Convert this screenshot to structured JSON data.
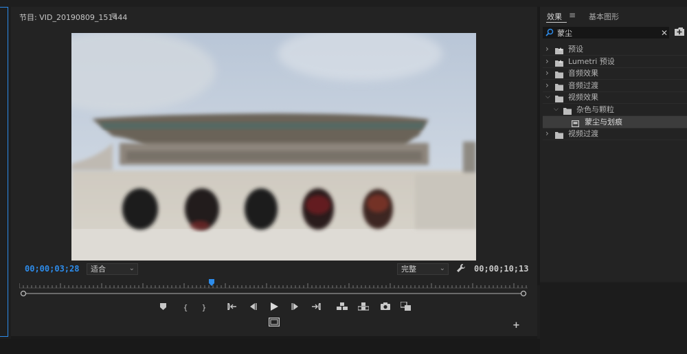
{
  "monitor": {
    "title": "节目: VID_20190809_151444",
    "menu_icon": "hamburger-menu-icon",
    "current_timecode": "00;00;03;28",
    "total_timecode": "00;00;10;13",
    "zoom_value": "适合",
    "quality_value": "完整",
    "playhead_fraction": 0.378,
    "accent_color": "#2d8ceb"
  },
  "transport": {
    "buttons": [
      "marker-icon",
      "mark-in-icon",
      "mark-out-icon",
      "go-to-in-icon",
      "step-back-icon",
      "play-icon",
      "step-forward-icon",
      "go-to-out-icon",
      "insert-icon",
      "overwrite-icon",
      "export-frame-icon",
      "comparison-view-icon"
    ],
    "compare_icon": "compare-view-icon",
    "add_icon": "plus-icon"
  },
  "effects_panel": {
    "tab_effects": "效果",
    "tab_graphics": "基本图形",
    "search_value": "蒙尘",
    "tree": [
      {
        "label": "预设",
        "level": 0,
        "expanded": false,
        "type": "preset-folder"
      },
      {
        "label": "Lumetri 预设",
        "level": 0,
        "expanded": false,
        "type": "preset-folder"
      },
      {
        "label": "音频效果",
        "level": 0,
        "expanded": false,
        "type": "folder"
      },
      {
        "label": "音频过渡",
        "level": 0,
        "expanded": false,
        "type": "folder"
      },
      {
        "label": "视频效果",
        "level": 0,
        "expanded": true,
        "type": "folder"
      },
      {
        "label": "杂色与颗粒",
        "level": 1,
        "expanded": true,
        "type": "folder"
      },
      {
        "label": "蒙尘与划痕",
        "level": 2,
        "expanded": false,
        "type": "effect",
        "selected": true
      },
      {
        "label": "视频过渡",
        "level": 0,
        "expanded": false,
        "type": "folder"
      }
    ]
  }
}
